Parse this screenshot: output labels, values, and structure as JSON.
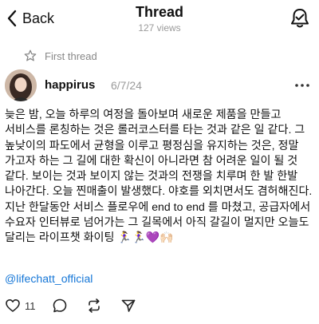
{
  "header": {
    "back_label": "Back",
    "title": "Thread",
    "views": "127 views"
  },
  "first_thread_label": "First thread",
  "post": {
    "username": "happirus",
    "date": "6/7/24",
    "body": "늦은 밤, 오늘 하루의 여정을 돌아보며 새로운 제품을 만들고 서비스를 론칭하는 것은 롤러코스터를 타는 것과 같은 일 같다. 그 높낮이의 파도에서 균형을 이루고 평정심을 유지하는 것은, 정말 가고자 하는 그 길에 대한 확신이 아니라면 참 어려운 일이 될 것 같다. 보이는 것과 보이지 않는 것과의 전쟁을 치루며 한 발 한발 나아간다. 오늘 찐매출이 발생했다. 야호를 외치면서도 겸허해진다. 지난 한달동안 서비스 플로우에 end to end 를 마쳤고, 공급자에서 수요자 인터뷰로 넘어가는 그 길목에서 아직 갈길이 멀지만 오늘도 달리는 라이프챗 화이팅 🏃‍♀️🏃‍♀️💜🙌🏻",
    "mention": "@lifechatt_official",
    "like_count": "11"
  },
  "icons": {
    "back": "chevron-left-icon",
    "header_action": "bell-icon",
    "first_thread": "star-icon",
    "more": "more-horizontal-icon",
    "like": "heart-icon",
    "comment": "comment-icon",
    "repost": "repost-icon",
    "share": "send-icon"
  },
  "colors": {
    "mention": "#1677d7",
    "muted": "#9a9a9a"
  }
}
